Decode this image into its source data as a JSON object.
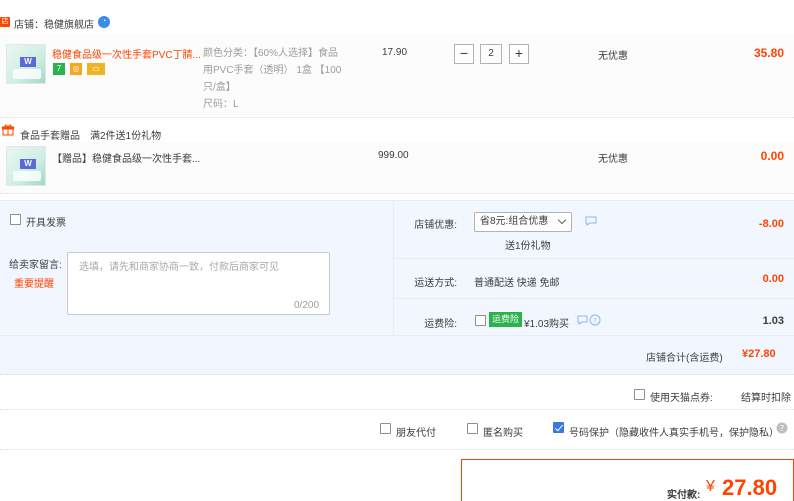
{
  "shop": {
    "tag_icon": "shop-tag-icon",
    "label": "店铺：稳健旗舰店",
    "ww_icon": "wangwang-icon"
  },
  "item": {
    "title": "稳健食品级一次性手套PVC丁腈...",
    "sku_lines": [
      "颜色分类：【60%人选择】食品",
      "用PVC手套（透明） 1盒 【100",
      "只/盒】",
      "尺码：L"
    ],
    "price": "17.90",
    "quantity": "2",
    "minus_label": "−",
    "plus_label": "+",
    "promo": "无优惠",
    "subtotal": "35.80",
    "service_icons": [
      "7-day-return-icon",
      "guarantee-icon",
      "card-icon"
    ]
  },
  "gift": {
    "label": "食品手套赠品",
    "rule": "满2件送1份礼物",
    "title": "【赠品】稳健食品级一次性手套...",
    "price": "999.00",
    "promo": "无优惠",
    "subtotal": "0.00"
  },
  "invoice": {
    "label": "开具发票"
  },
  "message": {
    "label": "给卖家留言:",
    "important_link": "重要提醒",
    "placeholder": "选填，请先和商家协商一致，付款后商家可见",
    "count": "0/200"
  },
  "shop_discount": {
    "label": "店铺优惠:",
    "selected": "省8元:组合优惠",
    "gift_note": "送1份礼物",
    "amount": "-8.00"
  },
  "shipping": {
    "label": "运送方式:",
    "method": "普通配送 快递 免邮",
    "amount": "0.00"
  },
  "insurance": {
    "label": "运费险:",
    "badge": "运费险",
    "price": "¥1.03购买",
    "amount": "1.03"
  },
  "shop_total": {
    "label": "店铺合计(含运费)",
    "amount": "¥27.80"
  },
  "tmall_points": {
    "label": "使用天猫点券:",
    "note": "结算时扣除"
  },
  "options": {
    "friend_pay": "朋友代付",
    "anonymous": "匿名购买",
    "number_protect": "号码保护（隐藏收件人真实手机号，保护隐私）"
  },
  "payment": {
    "label": "实付款:",
    "yen": "¥",
    "amount": "27.80"
  },
  "colors": {
    "accent": "#ff4400",
    "info_bg": "#f2f7ff",
    "check_blue": "#3a78dc"
  }
}
